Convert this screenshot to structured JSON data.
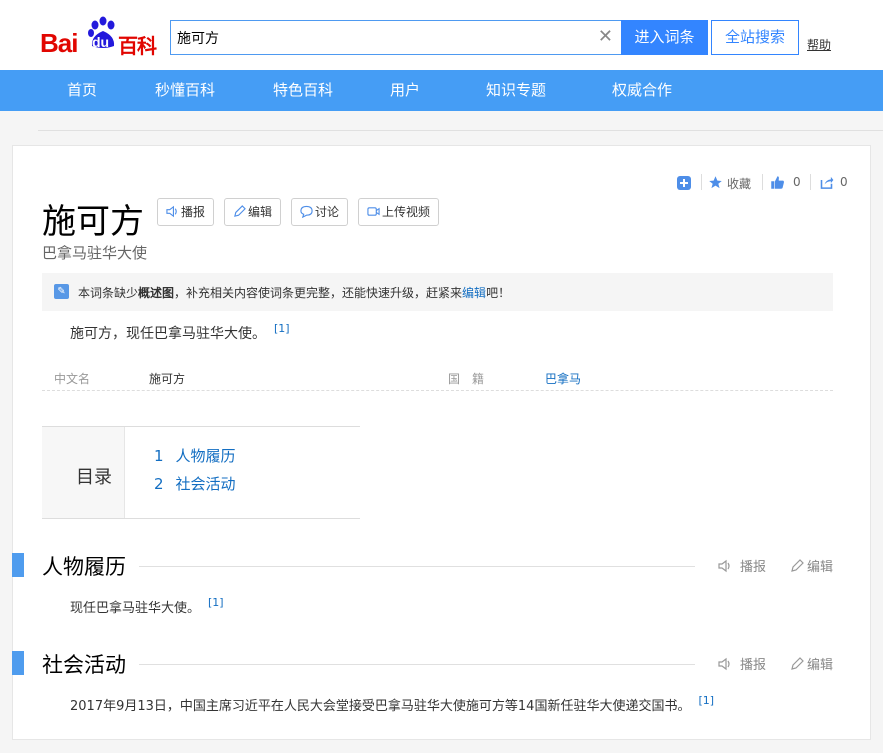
{
  "header": {
    "logo_bai": "Bai",
    "logo_du": "du",
    "logo_baike": "百科",
    "search_value": "施可方",
    "enter_button": "进入词条",
    "all_search_button": "全站搜索",
    "help": "帮助"
  },
  "nav": {
    "items": [
      {
        "label": "首页"
      },
      {
        "label": "秒懂百科"
      },
      {
        "label": "特色百科"
      },
      {
        "label": "用户"
      },
      {
        "label": "知识专题"
      },
      {
        "label": "权威合作"
      }
    ]
  },
  "entry": {
    "title": "施可方",
    "subtitle": "巴拿马驻华大使",
    "tools": {
      "play": "播报",
      "edit": "编辑",
      "discuss": "讨论",
      "upload_video": "上传视频"
    },
    "top_actions": {
      "collect": "收藏",
      "like_count": "0",
      "share_count": "0"
    },
    "notice": {
      "part1": "本词条缺少",
      "bold": "概述图",
      "part2": "，补充相关内容使词条更完整，还能快速升级，赶紧来",
      "link": "编辑",
      "part3": "吧！"
    },
    "summary": "施可方，现任巴拿马驻华大使。",
    "summary_ref": "[1]",
    "basic_info": [
      {
        "name": "中文名",
        "value": "施可方"
      },
      {
        "name": "国　籍",
        "value": "巴拿马"
      }
    ],
    "toc": {
      "title": "目录",
      "items": [
        {
          "num": "1",
          "label": "人物履历"
        },
        {
          "num": "2",
          "label": "社会活动"
        }
      ]
    },
    "sections": [
      {
        "title": "人物履历",
        "play": "播报",
        "edit": "编辑",
        "text": "现任巴拿马驻华大使。",
        "ref": "[1]"
      },
      {
        "title": "社会活动",
        "play": "播报",
        "edit": "编辑",
        "text": "2017年9月13日，中国主席习近平在人民大会堂接受巴拿马驻华大使施可方等14国新任驻华大使递交国书。",
        "ref": "[1]"
      }
    ]
  },
  "colors": {
    "nav_bg": "#459df5",
    "accent": "#3385ff",
    "link": "#136ec2",
    "logo_red": "#e10601"
  }
}
